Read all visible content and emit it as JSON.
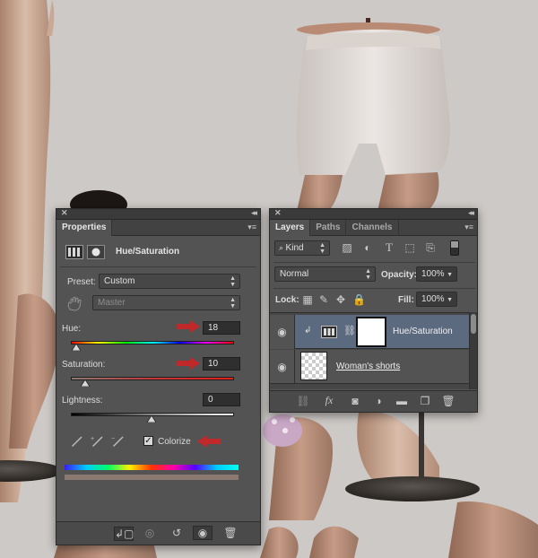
{
  "properties_panel": {
    "tab": "Properties",
    "adjustment_title": "Hue/Saturation",
    "preset_label": "Preset:",
    "preset_value": "Custom",
    "channel_value": "Master",
    "hue_label": "Hue:",
    "hue_value": "18",
    "saturation_label": "Saturation:",
    "saturation_value": "10",
    "lightness_label": "Lightness:",
    "lightness_value": "0",
    "colorize_label": "Colorize",
    "colorize_checked": true
  },
  "layers_panel": {
    "tabs": [
      "Layers",
      "Paths",
      "Channels"
    ],
    "filter_value": "Kind",
    "blend_mode": "Normal",
    "opacity_label": "Opacity:",
    "opacity_value": "100%",
    "lock_label": "Lock:",
    "fill_label": "Fill:",
    "fill_value": "100%",
    "layers": [
      {
        "name": "Hue/Saturation",
        "selected": true
      },
      {
        "name": "Woman's shorts"
      }
    ]
  },
  "colors": {
    "panel_bg": "#535353",
    "selected_layer": "#5c6a80",
    "annotation_arrow": "#c0282a"
  },
  "icons": {
    "properties_bottom": [
      "clip-to-layer-icon",
      "view-previous-icon",
      "reset-icon",
      "visibility-icon",
      "trash-icon"
    ],
    "layers_bottom": [
      "link-icon",
      "fx-icon",
      "mask-icon",
      "adjustment-icon",
      "folder-icon",
      "new-layer-icon",
      "trash-icon"
    ]
  }
}
